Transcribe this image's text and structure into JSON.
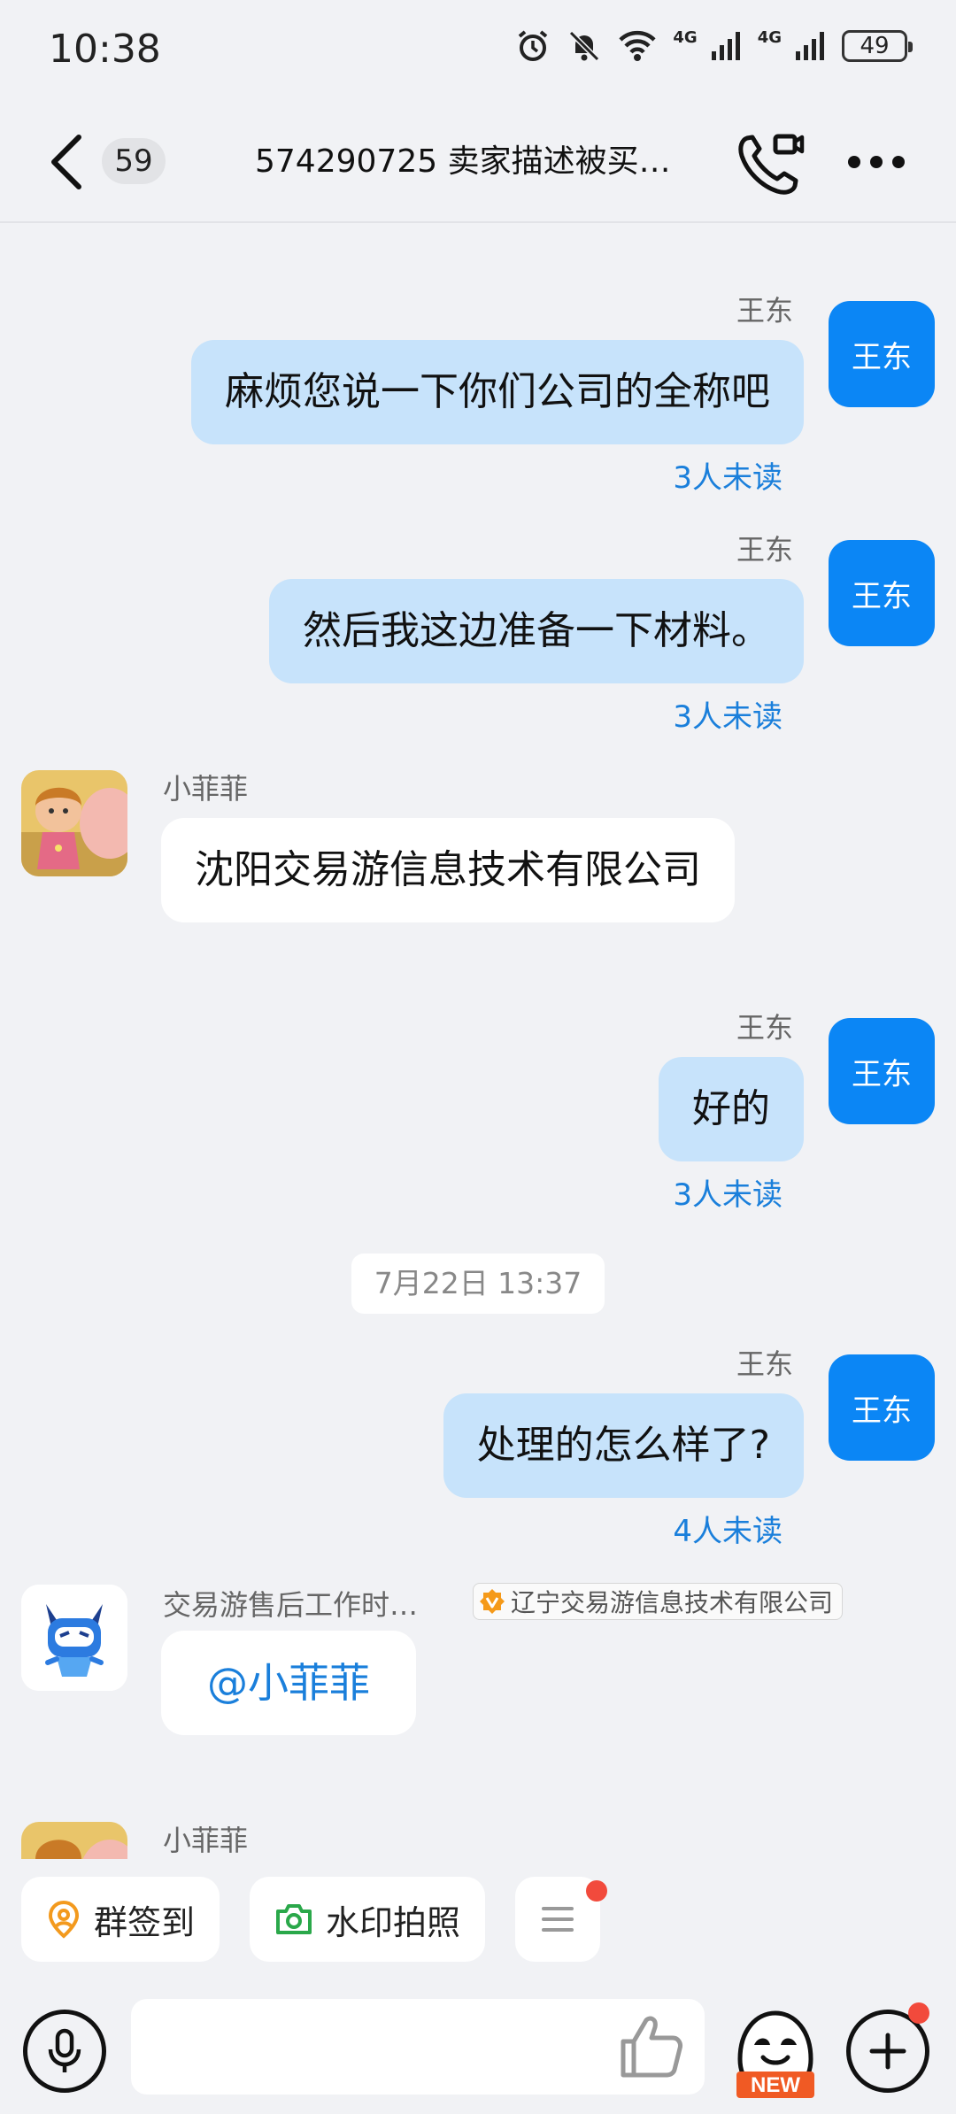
{
  "status_bar": {
    "time": "10:38",
    "network_1": "4G",
    "network_2": "4G",
    "battery": "49",
    "icons": [
      "alarm-icon",
      "mute-icon",
      "wifi-icon",
      "signal-icon",
      "signal-icon",
      "battery-icon"
    ]
  },
  "header": {
    "unread_count": "59",
    "title": "574290725 卖家描述被买家…"
  },
  "messages": [
    {
      "sender": "王东",
      "avatar": "王东",
      "text": "麻烦您说一下你们公司的全称吧",
      "status": "3人未读",
      "side": "right"
    },
    {
      "sender": "王东",
      "avatar": "王东",
      "text": "然后我这边准备一下材料。",
      "status": "3人未读",
      "side": "right"
    },
    {
      "sender": "小菲菲",
      "text": "沈阳交易游信息技术有限公司",
      "side": "left"
    },
    {
      "sender": "王东",
      "avatar": "王东",
      "text": "好的",
      "status": "3人未读",
      "side": "right"
    },
    {
      "sender": "王东",
      "avatar": "王东",
      "text": "处理的怎么样了?",
      "status": "4人未读",
      "side": "right"
    },
    {
      "sender": "交易游售后工作时…",
      "badge": "辽宁交易游信息技术有限公司",
      "text": "@小菲菲",
      "side": "left"
    },
    {
      "sender": "小菲菲",
      "side": "left"
    }
  ],
  "timestamp": "7月22日 13:37",
  "quick_actions": {
    "checkin": "群签到",
    "watermark_photo": "水印拍照"
  },
  "input": {
    "placeholder": ""
  },
  "emoji_badge": "NEW",
  "colors": {
    "accent": "#0b86f5",
    "bubble_me": "#c7e3fb",
    "read_status": "#1a7fdb",
    "background": "#f1f2f5"
  }
}
